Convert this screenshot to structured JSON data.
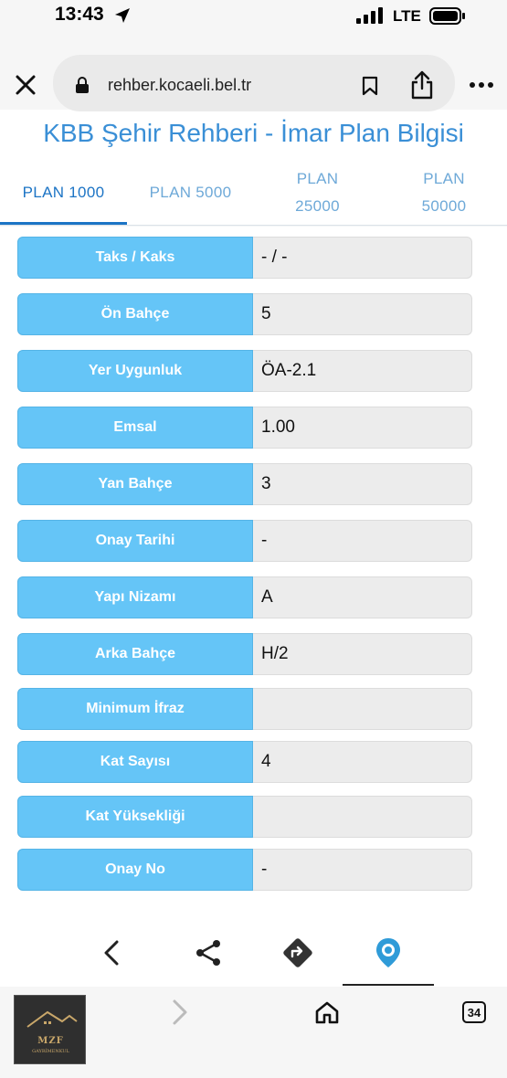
{
  "status_bar": {
    "time": "13:43",
    "network": "LTE",
    "icons": [
      "location-arrow-icon",
      "signal-bars-icon",
      "battery-icon"
    ]
  },
  "browser": {
    "url": "rehber.kocaeli.bel.tr",
    "icons": [
      "close-icon",
      "lock-icon",
      "bookmark-icon",
      "share-icon",
      "more-icon"
    ]
  },
  "page": {
    "title": "KBB Şehir Rehberi - İmar Plan Bilgisi",
    "tabs": [
      {
        "line1": "PLAN 1000",
        "line2": ""
      },
      {
        "line1": "PLAN 5000",
        "line2": ""
      },
      {
        "line1": "PLAN",
        "line2": "25000"
      },
      {
        "line1": "PLAN",
        "line2": "50000"
      }
    ],
    "active_tab": "PLAN 1000",
    "rows": [
      {
        "label": "Taks / Kaks",
        "value": "- / -"
      },
      {
        "label": "Ön Bahçe",
        "value": "5"
      },
      {
        "label": "Yer Uygunluk",
        "value": "ÖA-2.1"
      },
      {
        "label": "Emsal",
        "value": "1.00"
      },
      {
        "label": "Yan Bahçe",
        "value": "3"
      },
      {
        "label": "Onay Tarihi",
        "value": "-"
      },
      {
        "label": "Yapı Nizamı",
        "value": "A"
      },
      {
        "label": "Arka Bahçe",
        "value": "H/2"
      },
      {
        "label": "Minimum İfraz",
        "value": ""
      },
      {
        "label": "Kat Sayısı",
        "value": "4"
      },
      {
        "label": "Kat Yüksekliği",
        "value": ""
      },
      {
        "label": "Onay No",
        "value": "-"
      }
    ]
  },
  "app_bar": {
    "icons": [
      "back-chevron-icon",
      "share-nodes-icon",
      "directions-icon",
      "location-pin-icon"
    ]
  },
  "safari_toolbar": {
    "tab_count": "34",
    "icons": [
      "back-icon",
      "forward-icon",
      "home-icon",
      "tabs-icon"
    ]
  },
  "logo": {
    "name": "MZF",
    "subtitle": "GAYRİMENKUL"
  },
  "colors": {
    "label_bg": "#65c5f7",
    "value_bg": "#ececec",
    "title": "#3a8fd6",
    "active_tab": "#1c74c5"
  }
}
